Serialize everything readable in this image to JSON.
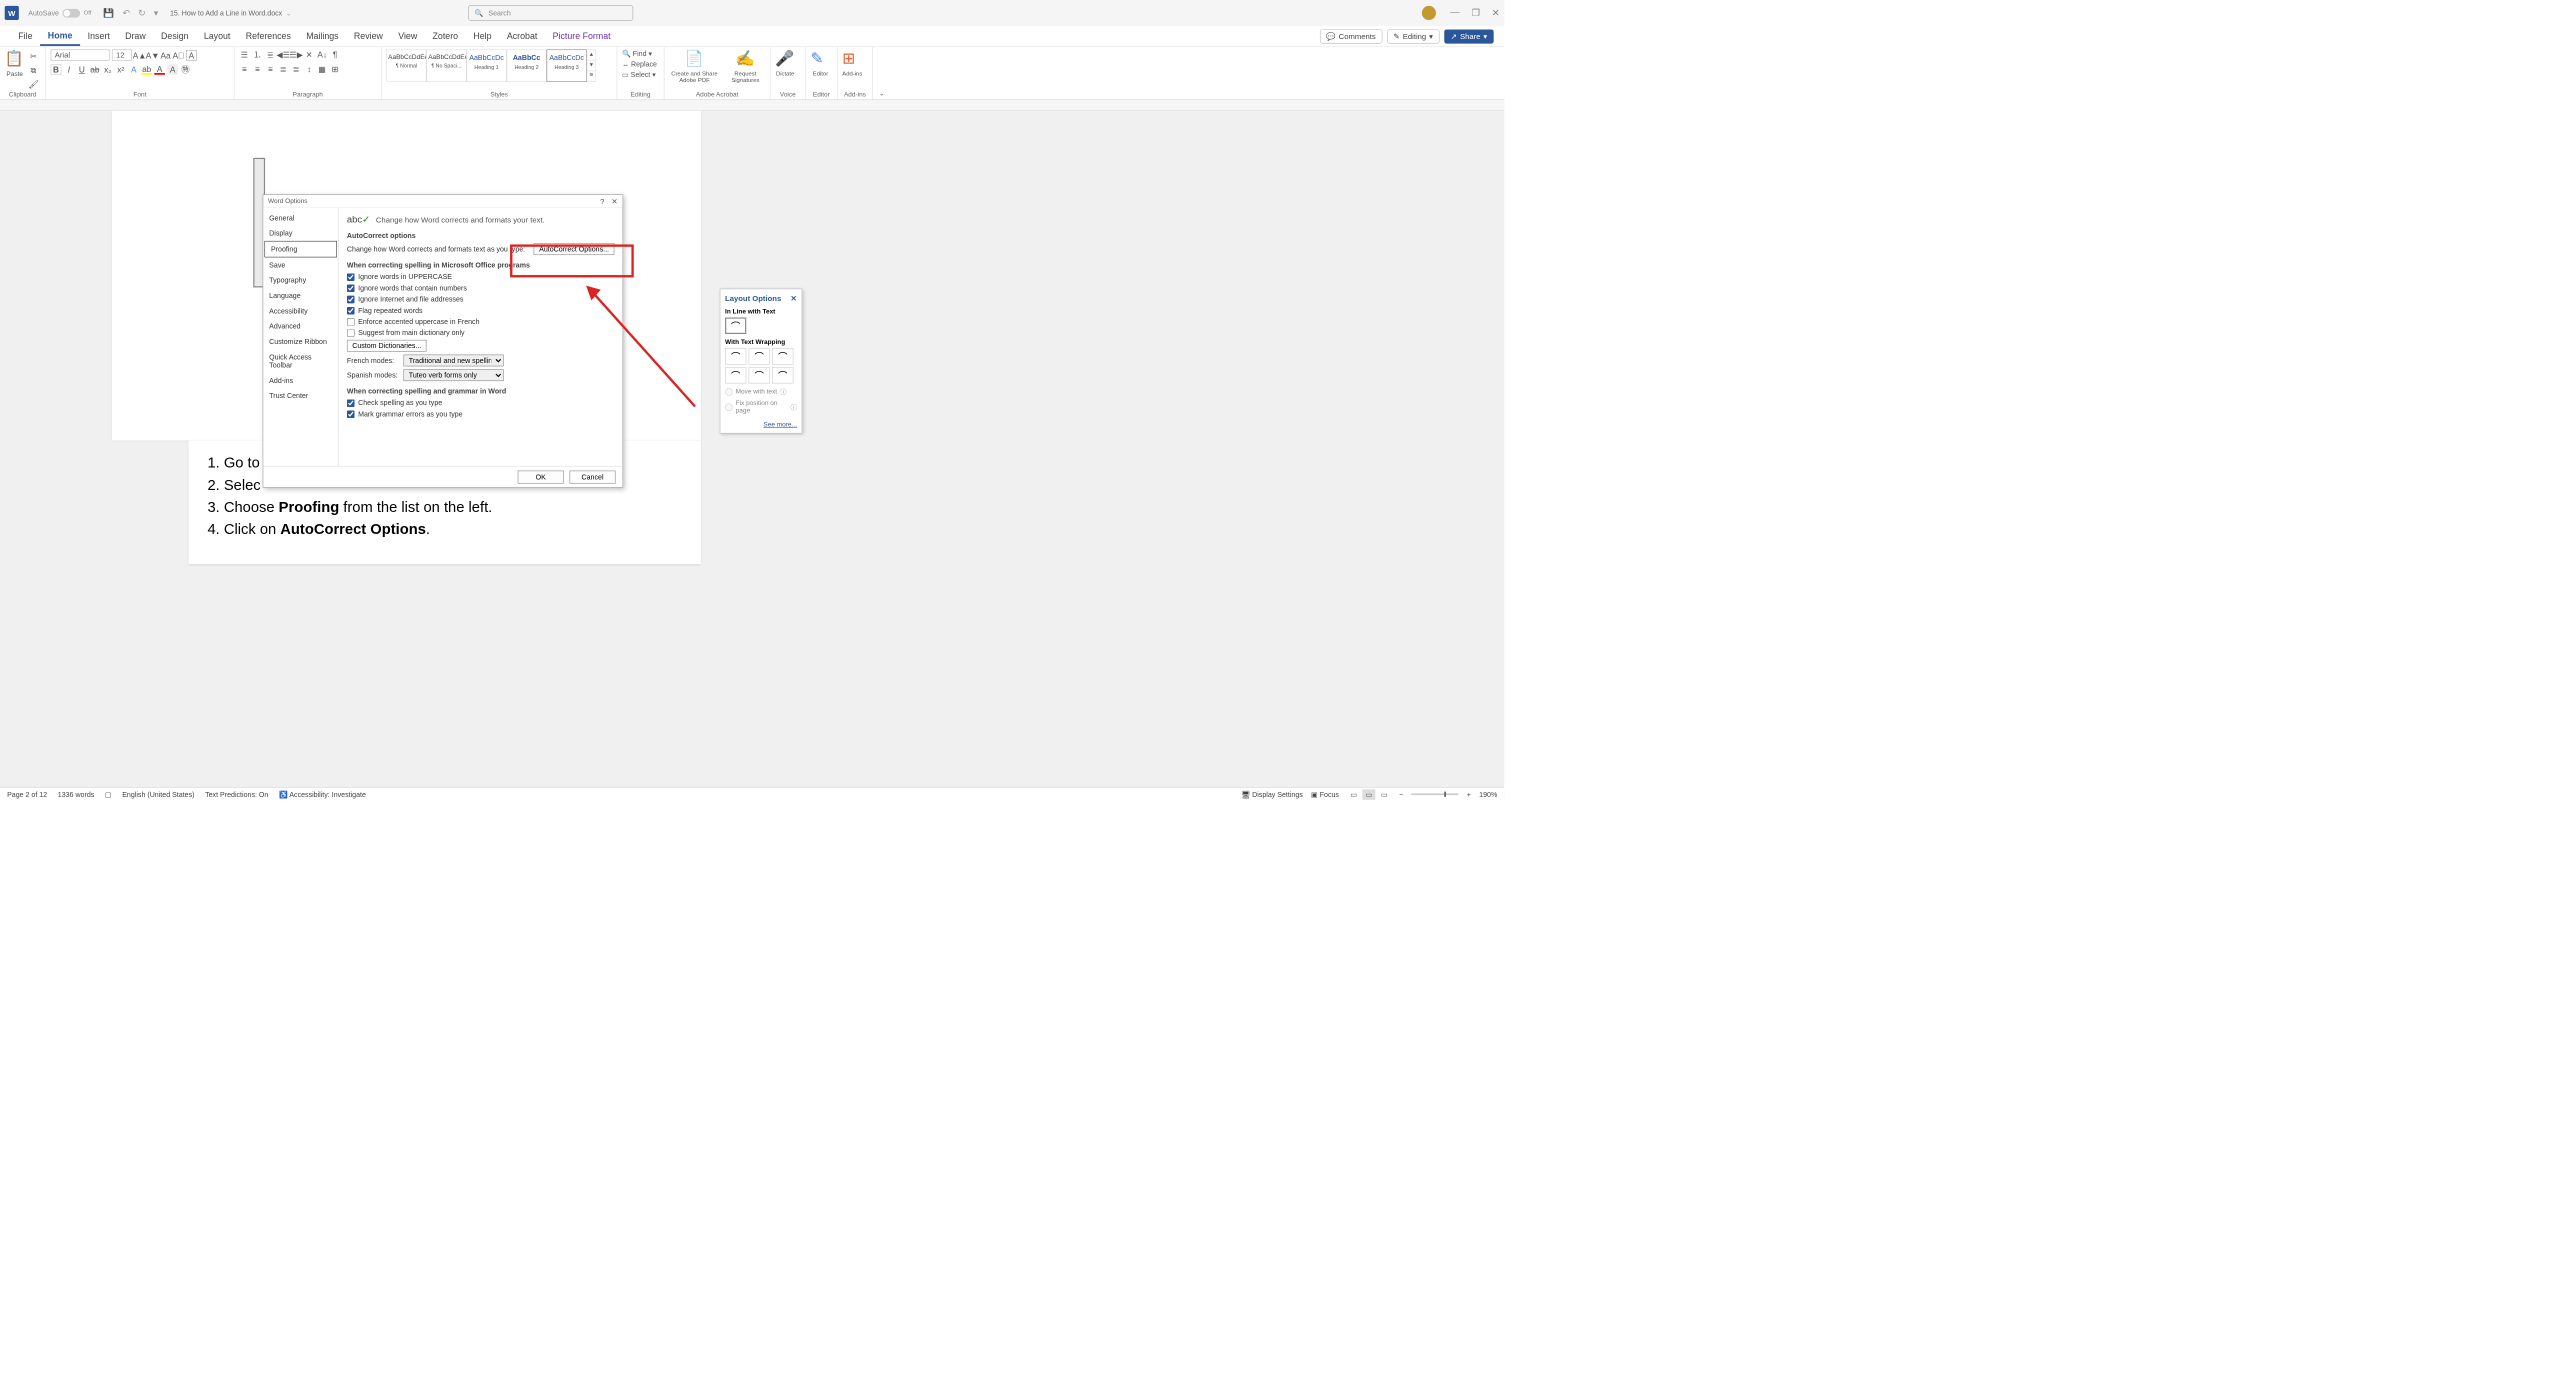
{
  "titlebar": {
    "autosave_label": "AutoSave",
    "autosave_state": "Off",
    "document_title": "15. How to Add a Line in Word.docx",
    "search_placeholder": "Search",
    "window_controls": {
      "minimize": "—",
      "restore": "❐",
      "close": "✕"
    }
  },
  "ribbon_tabs": [
    "File",
    "Home",
    "Insert",
    "Draw",
    "Design",
    "Layout",
    "References",
    "Mailings",
    "Review",
    "View",
    "Zotero",
    "Help",
    "Acrobat",
    "Picture Format"
  ],
  "ribbon_active_tab": "Home",
  "ribbon_right": {
    "comments": "Comments",
    "editing": "Editing",
    "share": "Share"
  },
  "ribbon": {
    "clipboard": {
      "paste": "Paste",
      "label": "Clipboard"
    },
    "font": {
      "name": "Arial",
      "size": "12",
      "label": "Font"
    },
    "paragraph": {
      "label": "Paragraph"
    },
    "styles": {
      "items": [
        {
          "preview": "AaBbCcDdEe",
          "name": "¶ Normal"
        },
        {
          "preview": "AaBbCcDdEe",
          "name": "¶ No Spaci..."
        },
        {
          "preview": "AaBbCcDc",
          "name": "Heading 1"
        },
        {
          "preview": "AaBbCc",
          "name": "Heading 2"
        },
        {
          "preview": "AaBbCcDc",
          "name": "Heading 3"
        }
      ],
      "label": "Styles"
    },
    "editing": {
      "find": "Find",
      "replace": "Replace",
      "select": "Select",
      "label": "Editing"
    },
    "adobe": {
      "create": "Create and Share Adobe PDF",
      "request": "Request Signatures",
      "label": "Adobe Acrobat"
    },
    "voice": {
      "dictate": "Dictate",
      "label": "Voice"
    },
    "editor": {
      "editor": "Editor",
      "label": "Editor"
    },
    "addins": {
      "addins": "Add-ins",
      "label": "Add-ins"
    }
  },
  "dialog": {
    "title": "Word Options",
    "help": "?",
    "close": "✕",
    "categories": [
      "General",
      "Display",
      "Proofing",
      "Save",
      "Typography",
      "Language",
      "Accessibility",
      "Advanced",
      "Customize Ribbon",
      "Quick Access Toolbar",
      "Add-ins",
      "Trust Center"
    ],
    "selected_category": "Proofing",
    "intro_abc": "abc",
    "intro_text": "Change how Word corrects and formats your text.",
    "section1": "AutoCorrect options",
    "section1_desc": "Change how Word corrects and formats text as you type:",
    "autocorrect_btn": "AutoCorrect Options...",
    "section2": "When correcting spelling in Microsoft Office programs",
    "checkboxes": [
      {
        "label": "Ignore words in UPPERCASE",
        "checked": true
      },
      {
        "label": "Ignore words that contain numbers",
        "checked": true
      },
      {
        "label": "Ignore Internet and file addresses",
        "checked": true
      },
      {
        "label": "Flag repeated words",
        "checked": true
      },
      {
        "label": "Enforce accented uppercase in French",
        "checked": false
      },
      {
        "label": "Suggest from main dictionary only",
        "checked": false
      }
    ],
    "custom_dict_btn": "Custom Dictionaries...",
    "french_modes_label": "French modes:",
    "french_modes_value": "Traditional and new spellings",
    "spanish_modes_label": "Spanish modes:",
    "spanish_modes_value": "Tuteo verb forms only",
    "section3": "When correcting spelling and grammar in Word",
    "checkboxes2": [
      {
        "label": "Check spelling as you type",
        "checked": true
      },
      {
        "label": "Mark grammar errors as you type",
        "checked": true
      }
    ],
    "ok": "OK",
    "cancel": "Cancel"
  },
  "layout_options": {
    "title": "Layout Options",
    "close": "✕",
    "inline_label": "In Line with Text",
    "wrapping_label": "With Text Wrapping",
    "radio1": "Move with text",
    "radio2": "Fix position on page",
    "see_more": "See more..."
  },
  "doc_steps": {
    "1": "Go to",
    "2": "Selec",
    "3_pre": "Choose ",
    "3_bold": "Proofing",
    "3_post": " from the list on the left.",
    "4_pre": "Click on ",
    "4_bold": "AutoCorrect Options",
    "4_post": "."
  },
  "statusbar": {
    "page": "Page 2 of 12",
    "words": "1336 words",
    "language": "English (United States)",
    "text_predictions": "Text Predictions: On",
    "accessibility": "Accessibility: Investigate",
    "display_settings": "Display Settings",
    "focus": "Focus",
    "zoom": "190%"
  }
}
